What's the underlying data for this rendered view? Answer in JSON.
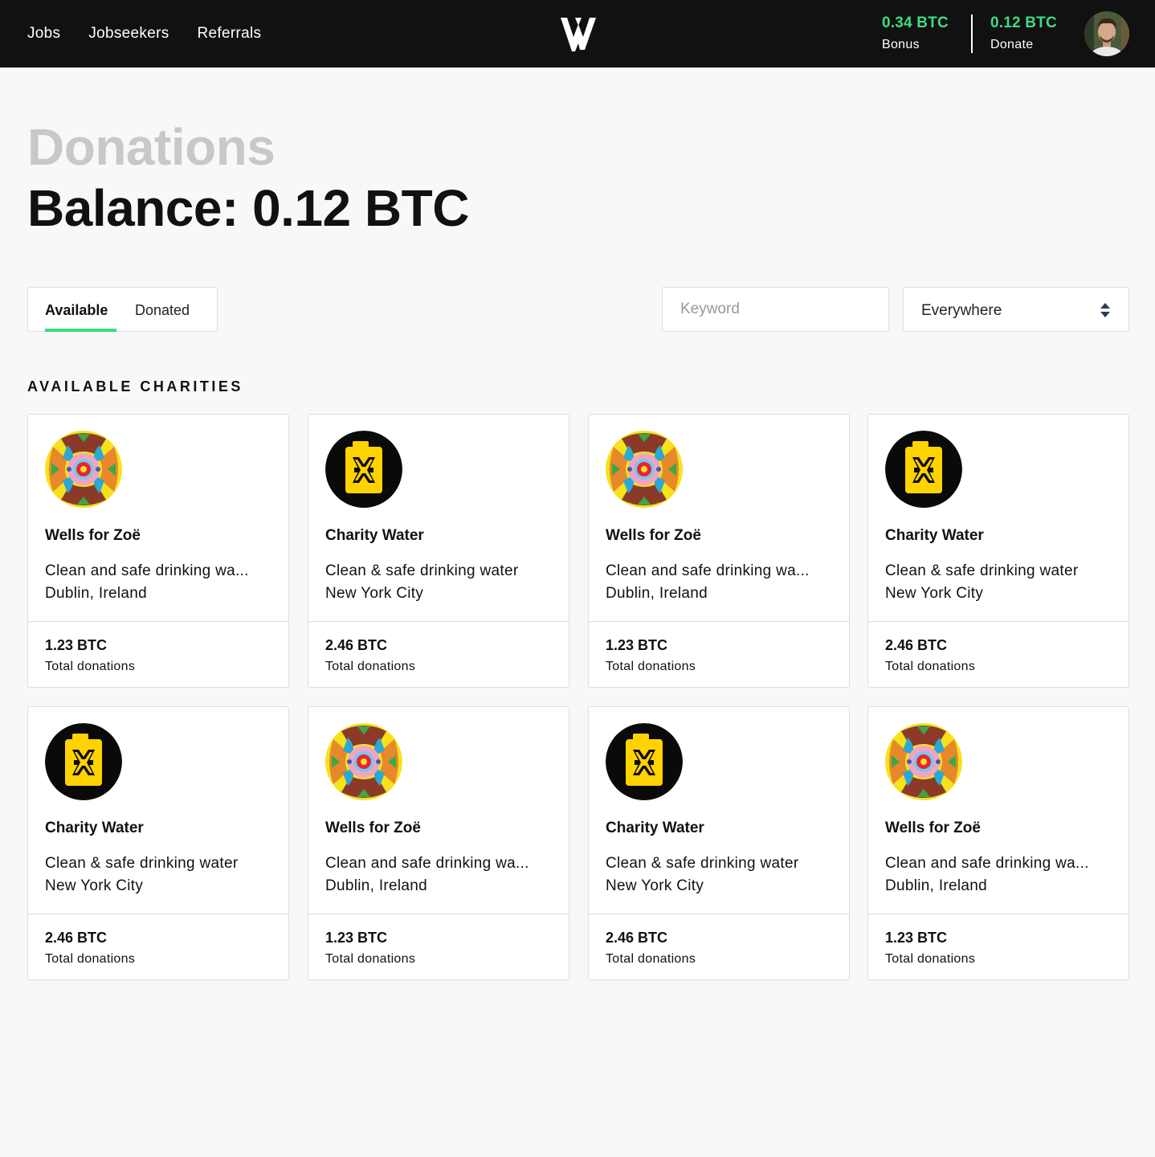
{
  "nav": {
    "items": [
      "Jobs",
      "Jobseekers",
      "Referrals"
    ]
  },
  "header": {
    "logo_icon": "wv-logo-icon",
    "bonus": {
      "value": "0.34 BTC",
      "label": "Bonus"
    },
    "donate": {
      "value": "0.12 BTC",
      "label": "Donate"
    },
    "accent_color": "#3ddc84"
  },
  "page": {
    "title": "Donations",
    "balance": "Balance: 0.12 BTC"
  },
  "tabs": {
    "items": [
      "Available",
      "Donated"
    ],
    "active": "Available"
  },
  "search": {
    "placeholder": "Keyword",
    "value": ""
  },
  "location_select": {
    "value": "Everywhere"
  },
  "section_title": "AVAILABLE CHARITIES",
  "charities": [
    {
      "name": "Wells for Zoë",
      "description": "Clean and safe drinking wa...",
      "location": "Dublin, Ireland",
      "amount": "1.23 BTC",
      "amount_label": "Total donations",
      "logo": "mandala"
    },
    {
      "name": "Charity Water",
      "description": "Clean & safe drinking water",
      "location": "New York City",
      "amount": "2.46 BTC",
      "amount_label": "Total donations",
      "logo": "jerrycan"
    },
    {
      "name": "Wells for Zoë",
      "description": "Clean and safe drinking wa...",
      "location": "Dublin, Ireland",
      "amount": "1.23 BTC",
      "amount_label": "Total donations",
      "logo": "mandala"
    },
    {
      "name": "Charity Water",
      "description": "Clean & safe drinking water",
      "location": "New York City",
      "amount": "2.46 BTC",
      "amount_label": "Total donations",
      "logo": "jerrycan"
    },
    {
      "name": "Charity Water",
      "description": "Clean & safe drinking water",
      "location": "New York City",
      "amount": "2.46 BTC",
      "amount_label": "Total donations",
      "logo": "jerrycan"
    },
    {
      "name": "Wells for Zoë",
      "description": "Clean and safe drinking wa...",
      "location": "Dublin, Ireland",
      "amount": "1.23 BTC",
      "amount_label": "Total donations",
      "logo": "mandala"
    },
    {
      "name": "Charity Water",
      "description": "Clean & safe drinking water",
      "location": "New York City",
      "amount": "2.46 BTC",
      "amount_label": "Total donations",
      "logo": "jerrycan"
    },
    {
      "name": "Wells for Zoë",
      "description": "Clean and safe drinking wa...",
      "location": "Dublin, Ireland",
      "amount": "1.23 BTC",
      "amount_label": "Total donations",
      "logo": "mandala"
    }
  ]
}
